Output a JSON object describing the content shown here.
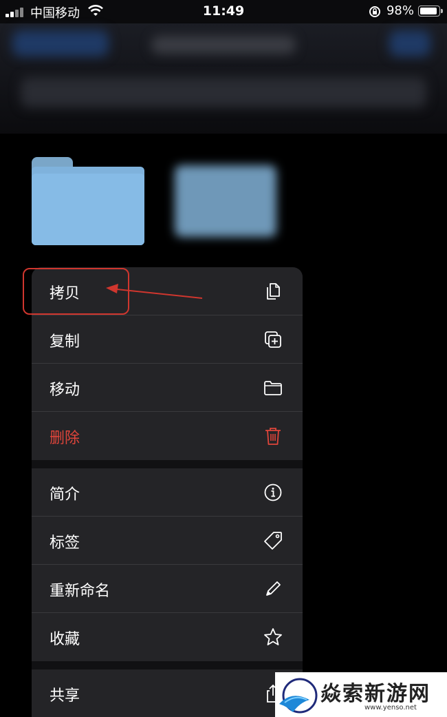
{
  "status_bar": {
    "carrier": "中国移动",
    "time": "11:49",
    "battery_percent": "98%",
    "battery_level": 0.98
  },
  "menu": {
    "items": [
      {
        "label": "拷贝",
        "icon": "copy-documents-icon"
      },
      {
        "label": "复制",
        "icon": "duplicate-icon"
      },
      {
        "label": "移动",
        "icon": "folder-icon"
      },
      {
        "label": "删除",
        "icon": "trash-icon",
        "destructive": true
      },
      {
        "label": "简介",
        "icon": "info-icon"
      },
      {
        "label": "标签",
        "icon": "tag-icon"
      },
      {
        "label": "重新命名",
        "icon": "pencil-icon"
      },
      {
        "label": "收藏",
        "icon": "star-icon"
      },
      {
        "label": "共享",
        "icon": "share-icon"
      }
    ]
  },
  "watermark": {
    "brand": "焱索新游网",
    "domain": "www.yenso.net"
  },
  "colors": {
    "menu_bg": "#242427",
    "destructive": "#e0453b",
    "annotation": "#d0362e",
    "folder": "#86bbe6"
  }
}
